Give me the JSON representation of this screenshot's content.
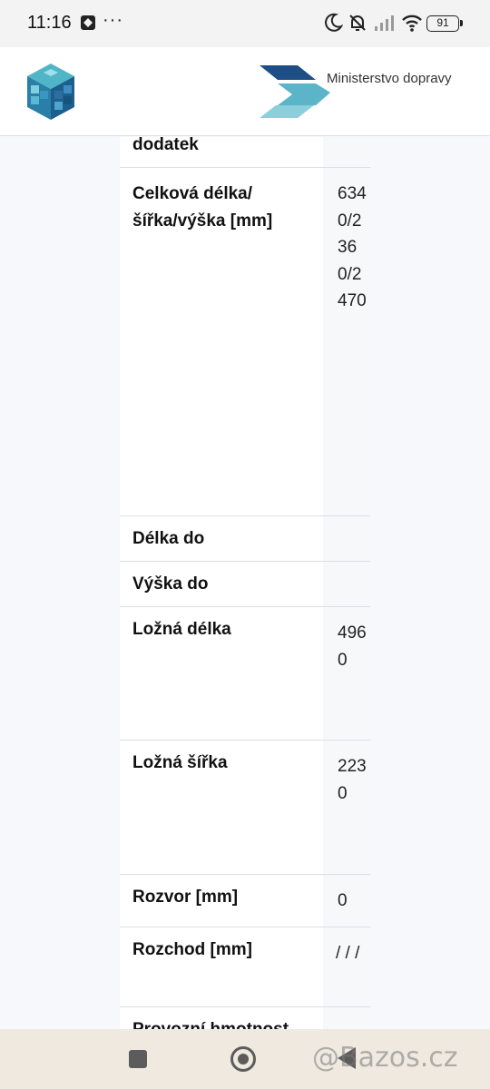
{
  "status_bar": {
    "time": "11:16",
    "dots": "···",
    "battery": "91"
  },
  "header": {
    "ministry_name": "Ministerstvo dopravy"
  },
  "rows": [
    {
      "label": "dodatek",
      "value": ""
    },
    {
      "label": "Celková délka/\nšířka/výška [mm]",
      "value": "6340/2360/2470"
    },
    {
      "label": "Délka do",
      "value": ""
    },
    {
      "label": "Výška do",
      "value": ""
    },
    {
      "label": "Ložná délka",
      "value": "4960"
    },
    {
      "label": "Ložná šířka",
      "value": "2230"
    },
    {
      "label": "Rozvor [mm]",
      "value": "0"
    },
    {
      "label": "Rozchod [mm]",
      "value": "/ / /"
    },
    {
      "label": "Provozní hmotnost",
      "value": "-"
    }
  ],
  "watermark": "@Bazos.cz"
}
